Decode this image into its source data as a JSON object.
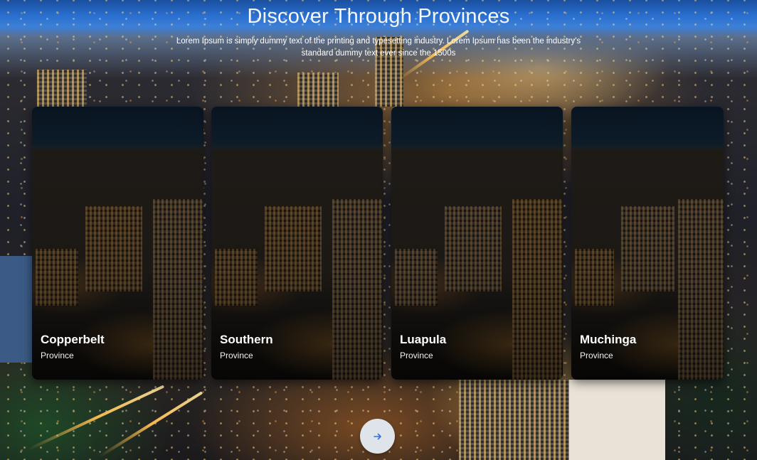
{
  "header": {
    "title": "Discover Through Provinces",
    "subtitle": "Lorem Ipsum is simply dummy text of the printing and typesetting industry. Lorem Ipsum has been the industry's standard dummy text ever since the 1500s"
  },
  "cards": [
    {
      "name": "Copperbelt",
      "label": "Province"
    },
    {
      "name": "Southern",
      "label": "Province"
    },
    {
      "name": "Luapula",
      "label": "Province"
    },
    {
      "name": "Muchinga",
      "label": "Province"
    }
  ],
  "controls": {
    "next_icon": "arrow-right-icon",
    "next_button_color": "#dfe3ea",
    "next_icon_color": "#2f6fe0"
  }
}
